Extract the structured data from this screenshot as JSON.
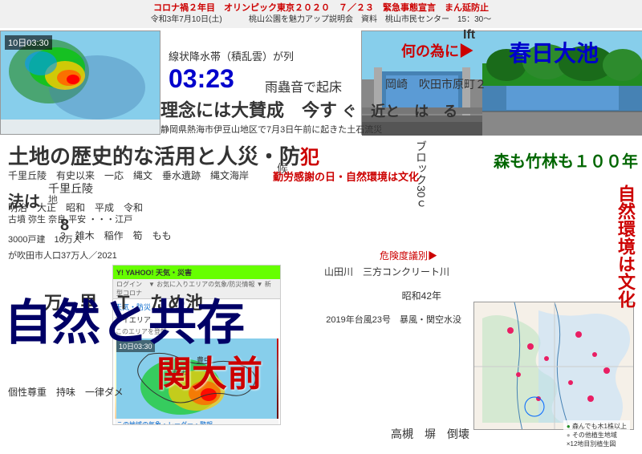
{
  "topbar": {
    "line1": "コロナ禍２年目　オリンピック東京２０２０　７／２３　緊急事態宣言　まん延防止",
    "line2_a": "令和3年7月10日(土)",
    "line2_b": "桃山公園を魅力アップ説明会　資料　桃山市民センター　15：30～"
  },
  "map_timestamp1": "10日03:30",
  "texts": {
    "t1": "線状降水帯（積乱雲）が列",
    "t2": "03:23",
    "t3": "雨蟲音で起床",
    "t4": "岡崎　吹田市原町２",
    "t5": "何の為に▶",
    "t6": "春日大池",
    "t7": "理念には大賛成　今す",
    "t7b": "ぐ　近と　は　る",
    "t8": "静岡県熱海市伊豆山地区で7月3日午前に起きた土石流災",
    "t9": "土地の歴史的な活用と人災・防",
    "t9b": "犯",
    "t10": "候",
    "t11": "千里丘陵　有史以来　一応　縄文　垂水遺跡　縄文海岸",
    "t12": "千里丘陵",
    "t13": "地",
    "t14": "明治　大正　昭和　平成　令和",
    "t15": "古墳 弥生 奈良 平安 ・・・江戸",
    "t16": "8",
    "t17": "3　雑木　稲作　筍　もも",
    "t18": "法は",
    "t19": "3000戸建　10万人",
    "t20": "が吹田市人口37万人／2021",
    "t21": "自然と共存",
    "t22": "個性尊重　持味　一律ダメ",
    "t23": "ブロック30ｃ",
    "t24": "危険度議別▶",
    "t25": "山田川　三方コンクリート川",
    "t26": "昭和42年",
    "t27": "2019年台風23号　暴風・関空水没",
    "t28": "森も竹林も１００年",
    "t29": "自然環境は文化",
    "t30": "高槻　塀　倒壊",
    "t31": "勤労感謝の日・自然環境は文化",
    "t32": "万　里　Ｔ　ため池",
    "t33": "関大前",
    "map_ts2": "10日03:30"
  },
  "legend": {
    "items": [
      "森んでも木1株以上",
      "その他植生地域",
      "×12地目別植生図"
    ]
  },
  "yahoo": {
    "header": "YAHOO! 天気・災害",
    "toolbar": "ログイン　▼ お気に入りエリアの気象/防災情報 ▼ 新型コロナ",
    "nav": "天気・防災",
    "search_placeholder": "このエリアを登録",
    "map_label": "マイエリア",
    "radar_ts": "10日03:30",
    "bottom_link": "この地域の気象・レーダー・警報"
  }
}
